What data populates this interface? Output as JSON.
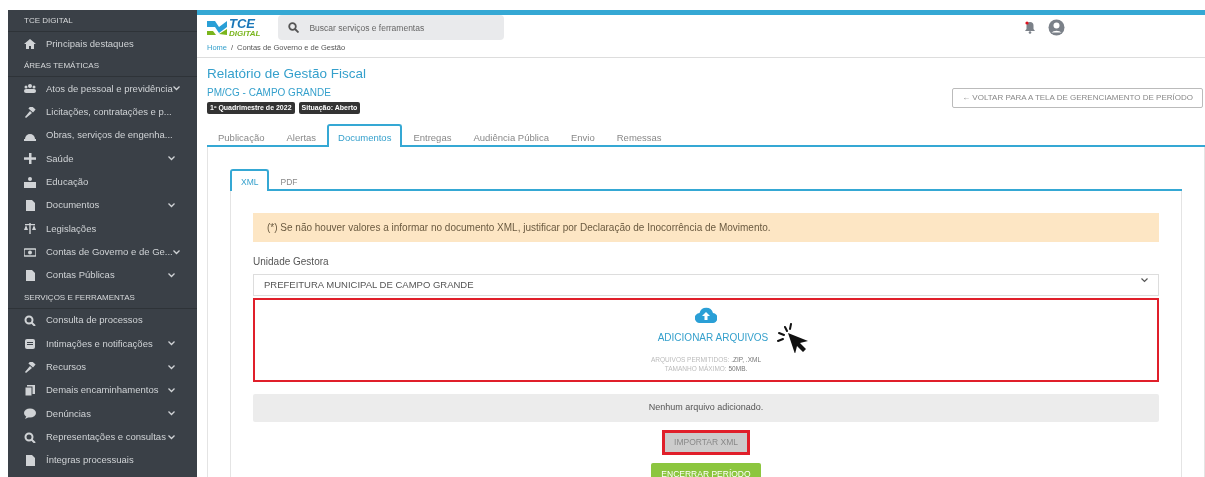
{
  "sidebar": {
    "items": [
      {
        "kind": "header",
        "label": "TCE DIGITAL"
      },
      {
        "kind": "item",
        "label": "Principais destaques",
        "expandable": false
      },
      {
        "kind": "header",
        "label": "ÁREAS TEMÁTICAS"
      },
      {
        "kind": "item",
        "label": "Atos de pessoal e previdência",
        "expandable": true
      },
      {
        "kind": "item",
        "label": "Licitações, contratações e p...",
        "expandable": false
      },
      {
        "kind": "item",
        "label": "Obras, serviços de engenha...",
        "expandable": false
      },
      {
        "kind": "item",
        "label": "Saúde",
        "expandable": true
      },
      {
        "kind": "item",
        "label": "Educação",
        "expandable": false
      },
      {
        "kind": "item",
        "label": "Documentos",
        "expandable": true
      },
      {
        "kind": "item",
        "label": "Legislações",
        "expandable": false
      },
      {
        "kind": "item",
        "label": "Contas de Governo e de Ge...",
        "expandable": true
      },
      {
        "kind": "item",
        "label": "Contas Públicas",
        "expandable": true
      },
      {
        "kind": "header",
        "label": "SERVIÇOS E FERRAMENTAS"
      },
      {
        "kind": "item",
        "label": "Consulta de processos",
        "expandable": false
      },
      {
        "kind": "item",
        "label": "Intimações e notificações",
        "expandable": true
      },
      {
        "kind": "item",
        "label": "Recursos",
        "expandable": true
      },
      {
        "kind": "item",
        "label": "Demais encaminhamentos",
        "expandable": true
      },
      {
        "kind": "item",
        "label": "Denúncias",
        "expandable": true
      },
      {
        "kind": "item",
        "label": "Representações e consultas",
        "expandable": true
      },
      {
        "kind": "item",
        "label": "Íntegras processuais",
        "expandable": false
      }
    ]
  },
  "header": {
    "logo_text": "TCE",
    "logo_subtext": "DIGITAL",
    "search": {
      "placeholder": "Buscar serviços e ferramentas"
    },
    "notification_dot": true
  },
  "breadcrumb": {
    "separator": "/",
    "items": [
      {
        "label": "Home",
        "link": true
      },
      {
        "label": "Contas de Governo e de Gestão",
        "link": false
      }
    ]
  },
  "page": {
    "title": "Relatório de Gestão Fiscal",
    "subtitle": "PM/CG - CAMPO GRANDE",
    "badges": [
      "1º Quadrimestre de 2022",
      "Situação: Aberto"
    ],
    "back_button": "← VOLTAR PARA A TELA DE GERENCIAMENTO DE PERÍODO"
  },
  "tabs": [
    {
      "label": "Publicação",
      "selected": false
    },
    {
      "label": "Alertas",
      "selected": false
    },
    {
      "label": "Documentos",
      "selected": true
    },
    {
      "label": "Entregas",
      "selected": false
    },
    {
      "label": "Audiência Pública",
      "selected": false
    },
    {
      "label": "Envio",
      "selected": false
    },
    {
      "label": "Remessas",
      "selected": false
    }
  ],
  "subtabs": [
    {
      "label": "XML",
      "selected": true
    },
    {
      "label": "PDF",
      "selected": false
    }
  ],
  "alert": "(*) Se não houver valores a informar no documento XML, justificar por Declaração de Inocorrência de Movimento.",
  "unit": {
    "label": "Unidade Gestora",
    "value": "PREFEITURA MUNICIPAL DE CAMPO GRANDE"
  },
  "upload": {
    "highlighted": true,
    "link": "ADICIONAR ARQUIVOS",
    "allowed_label": "ARQUIVOS PERMITIDOS:",
    "allowed_value": ".ZIP, .XML",
    "size_label": "TAMANHO MÁXIMO:",
    "size_value": "50MB."
  },
  "files_message": "Nenhum arquivo adicionado.",
  "import_button": {
    "label": "IMPORTAR XML",
    "highlighted": true
  },
  "close_button": "ENCERRAR PERÍODO"
}
